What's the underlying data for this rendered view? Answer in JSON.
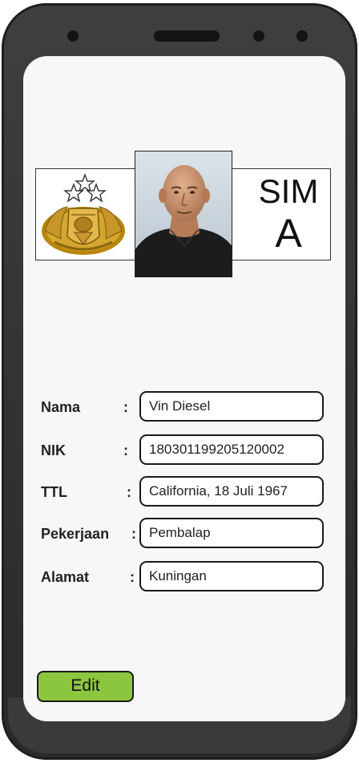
{
  "card": {
    "sim_label": "SIM",
    "sim_class": "A",
    "photo_subject": "portrait-photo",
    "emblem_name": "police-emblem-icon"
  },
  "fields": [
    {
      "label": "Nama",
      "value": "Vin Diesel"
    },
    {
      "label": "NIK",
      "value": "180301199205120002"
    },
    {
      "label": "TTL",
      "value": "California, 18 Juli 1967"
    },
    {
      "label": "Pekerjaan",
      "value": "Pembalap"
    },
    {
      "label": "Alamat",
      "value": "Kuningan"
    }
  ],
  "colon": ":",
  "actions": {
    "edit_label": "Edit"
  },
  "colors": {
    "edit_button": "#8cc63f",
    "phone_body": "#333333"
  }
}
